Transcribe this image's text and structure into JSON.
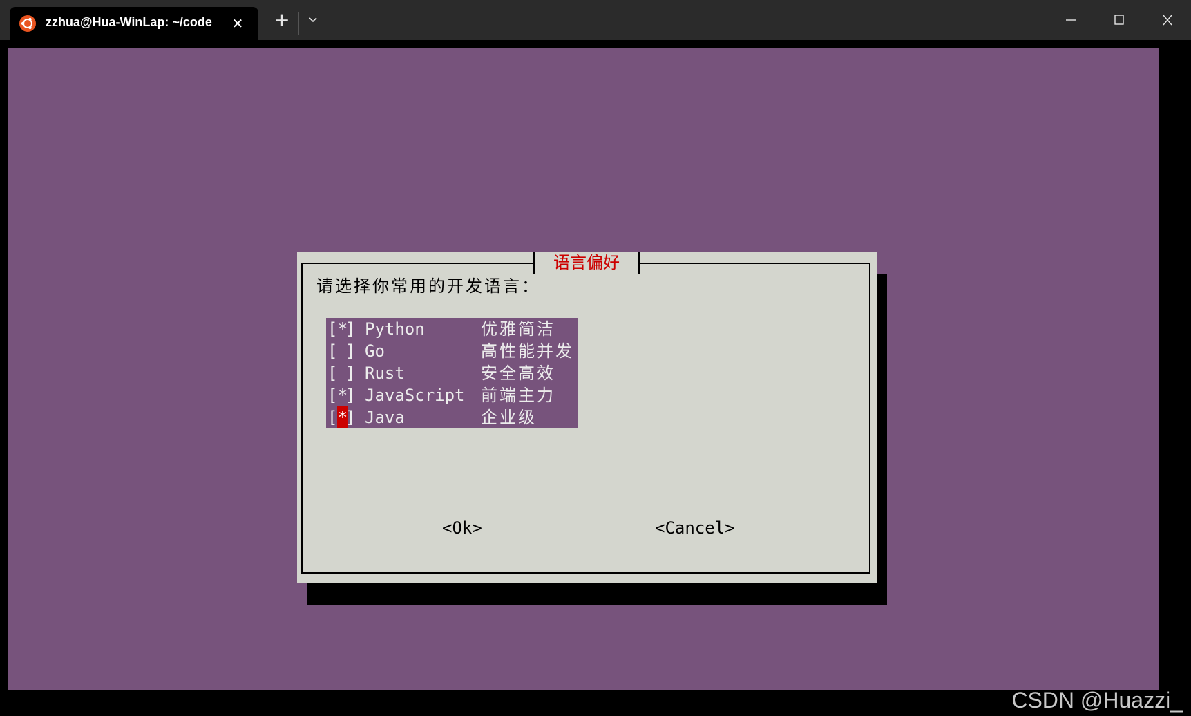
{
  "window": {
    "tab_title": "zzhua@Hua-WinLap: ~/code",
    "tab_icon": "ubuntu-icon",
    "tab_close": "✕",
    "new_tab": "+",
    "dropdown": "⌄",
    "minimize": "—",
    "maximize": "☐",
    "close": "✕"
  },
  "colors": {
    "terminal_bg": "#77537c",
    "dialog_bg": "#d4d6ce",
    "title_color": "#cc0000",
    "cursor_bg": "#cc0000"
  },
  "dialog": {
    "title": "语言偏好",
    "prompt": "请选择你常用的开发语言：",
    "items": [
      {
        "mark": "*",
        "language": "Python",
        "description": "优雅简洁",
        "checked": true,
        "cursor": false
      },
      {
        "mark": " ",
        "language": "Go",
        "description": "高性能并发",
        "checked": false,
        "cursor": false
      },
      {
        "mark": " ",
        "language": "Rust",
        "description": "安全高效",
        "checked": false,
        "cursor": false
      },
      {
        "mark": "*",
        "language": "JavaScript",
        "description": "前端主力",
        "checked": true,
        "cursor": false
      },
      {
        "mark": "*",
        "language": "Java",
        "description": "企业级",
        "checked": true,
        "cursor": true
      }
    ],
    "ok_label": "<Ok>",
    "cancel_label": "<Cancel>"
  },
  "watermark": "CSDN @Huazzi_"
}
